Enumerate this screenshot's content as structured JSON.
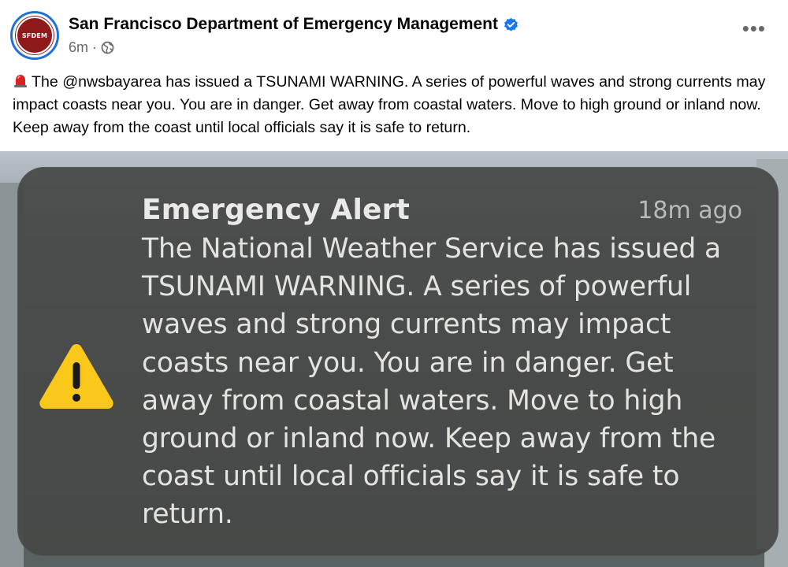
{
  "post": {
    "page_name": "San Francisco Department of Emergency Management",
    "timestamp": "6m",
    "separator": "·",
    "avatar_text": "SFDEM",
    "audience_icon": "globe-icon",
    "more_label": "•••",
    "text": "The @nwsbayarea has issued a TSUNAMI WARNING. A series of powerful waves and strong currents may impact coasts near you. You are in danger. Get away from coastal waters. Move to high ground or inland now. Keep away from the coast until local officials say it is safe to return."
  },
  "alert": {
    "title": "Emergency Alert",
    "time": "18m ago",
    "body": "The National Weather Service has issued a TSUNAMI WARNING. A series of powerful waves and strong currents may impact coasts near you. You are in danger. Get away from coastal waters. Move to high ground or inland now. Keep away from the coast until local officials say it is safe to return.",
    "icon": "warning-triangle-icon"
  },
  "colors": {
    "verified_blue": "#1877f2",
    "warning_yellow": "#f9c81a",
    "card_background": "#464846",
    "avatar_red": "#8f1a1c"
  }
}
